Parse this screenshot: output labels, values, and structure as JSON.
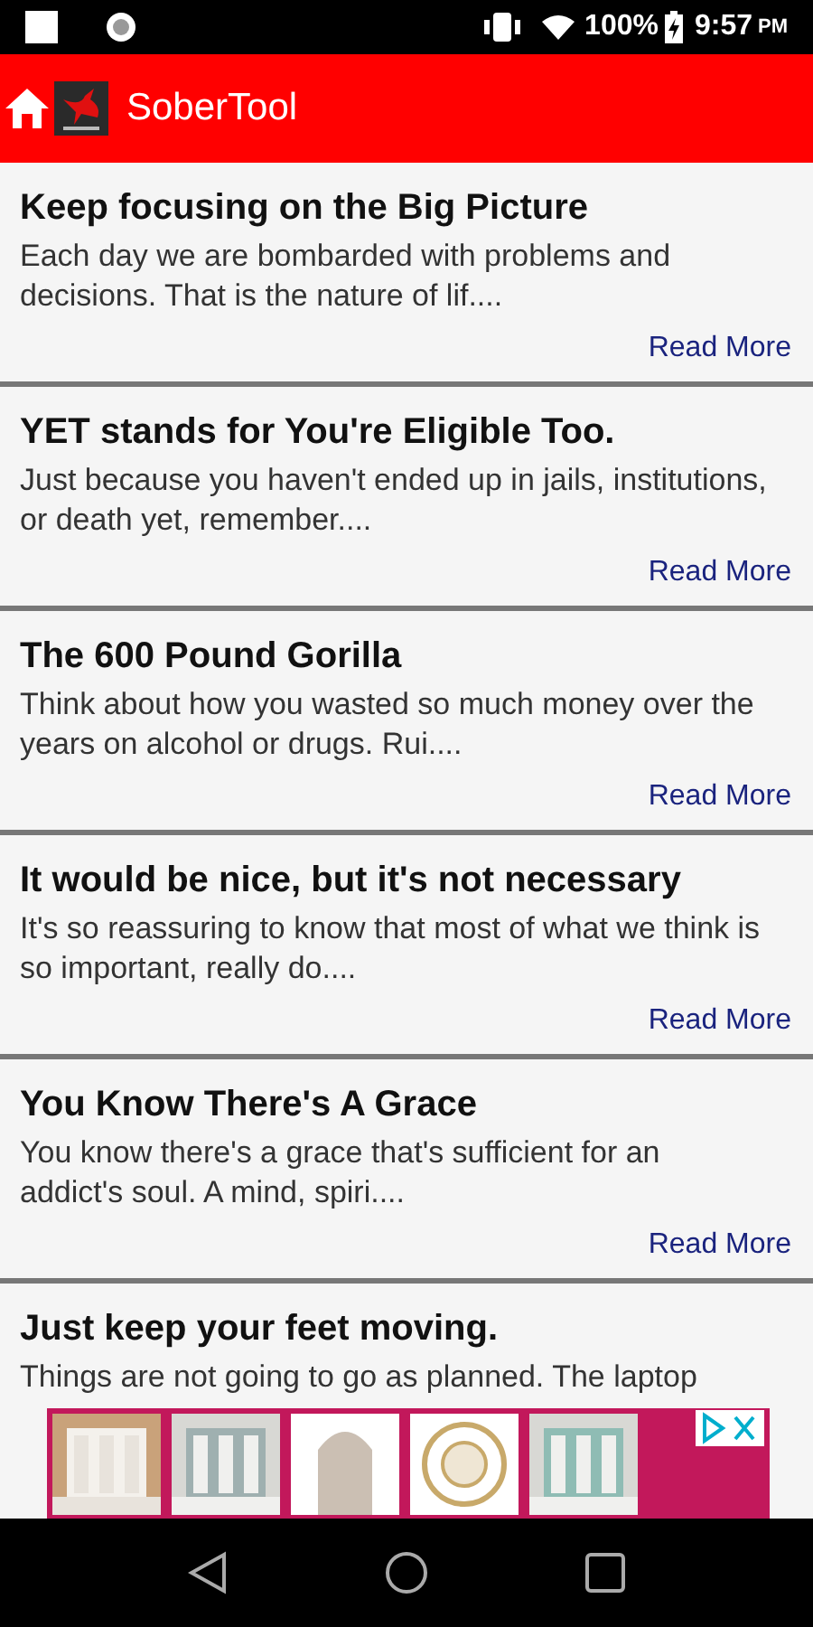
{
  "status_bar": {
    "battery": "100%",
    "time": "9:57",
    "ampm": "PM"
  },
  "app_bar": {
    "title": "SoberTool"
  },
  "articles": [
    {
      "title": "Keep focusing on the Big Picture",
      "excerpt": "Each day we are bombarded with problems and decisions. That is the nature of lif....",
      "link": "Read More"
    },
    {
      "title": "YET stands for You're Eligible Too.",
      "excerpt": "Just because you haven't ended up in jails, institutions, or death yet, remember....",
      "link": "Read More"
    },
    {
      "title": "The 600 Pound Gorilla",
      "excerpt": "Think about how you wasted so much money over the years on alcohol or drugs. Rui....",
      "link": "Read More"
    },
    {
      "title": "It would be nice, but it's not necessary",
      "excerpt": "It's so reassuring to know that most of what we think is so important, really do....",
      "link": "Read More"
    },
    {
      "title": "You Know There's A Grace",
      "excerpt": "You know there's a grace that's sufficient for an addict's soul.   A mind, spiri....",
      "link": "Read More"
    },
    {
      "title": "Just keep your feet moving.",
      "excerpt": "Things are not going to go as planned. The laptop"
    }
  ]
}
